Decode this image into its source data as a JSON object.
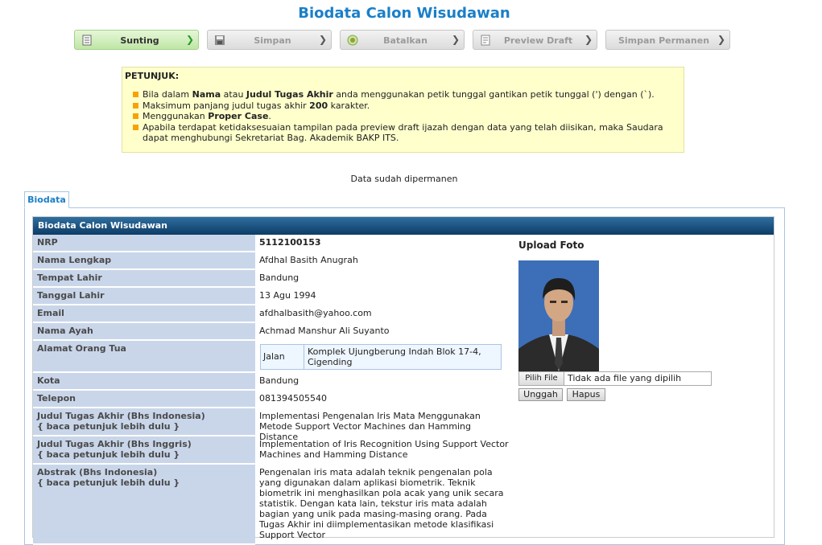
{
  "page_title": "Biodata Calon Wisudawan",
  "toolbar": [
    {
      "label": "Sunting",
      "icon": "edit-icon",
      "active": true
    },
    {
      "label": "Simpan",
      "icon": "save-icon",
      "active": false
    },
    {
      "label": "Batalkan",
      "icon": "cancel-icon",
      "active": false
    },
    {
      "label": "Preview Draft",
      "icon": "preview-icon",
      "active": false
    },
    {
      "label": "Simpan Permanen",
      "icon": "",
      "active": false
    }
  ],
  "petunjuk": {
    "heading": "PETUNJUK:",
    "item1": {
      "a": "Bila dalam ",
      "b": "Nama",
      "c": " atau ",
      "d": "Judul Tugas Akhir",
      "e": " anda menggunakan petik tunggal gantikan petik tunggal (') dengan (`)."
    },
    "item2": {
      "a": "Maksimum panjang judul tugas akhir ",
      "b": "200",
      "c": " karakter."
    },
    "item3": {
      "a": "Menggunakan ",
      "b": "Proper Case",
      "c": "."
    },
    "item4": "Apabila terdapat ketidaksesuaian tampilan pada preview draft ijazah dengan data yang telah diisikan, maka Saudara dapat menghubungi Sekretariat Bag. Akademik BAKP ITS."
  },
  "status_message": "Data sudah dipermanen",
  "tab_label": "Biodata",
  "form": {
    "header": "Biodata Calon Wisudawan",
    "nrp_label": "NRP",
    "nrp": "5112100153",
    "nama_label": "Nama Lengkap",
    "nama": "Afdhal Basith Anugrah",
    "tempat_label": "Tempat Lahir",
    "tempat": "Bandung",
    "tanggal_label": "Tanggal Lahir",
    "tanggal": "13 Agu 1994",
    "email_label": "Email",
    "email": "afdhalbasith@yahoo.com",
    "ayah_label": "Nama Ayah",
    "ayah": "Achmad Manshur Ali Suyanto",
    "alamat_label": "Alamat Orang Tua",
    "alamat_key": "Jalan",
    "alamat_value": "Komplek Ujungberung Indah Blok 17-4, Cigending",
    "kota_label": "Kota",
    "kota": "Bandung",
    "telepon_label": "Telepon",
    "telepon": "081394505540",
    "judul_id_label": "Judul Tugas Akhir (Bhs Indonesia)",
    "judul_id_hint": "{ baca petunjuk lebih dulu }",
    "judul_id": "Implementasi Pengenalan Iris Mata Menggunakan Metode Support Vector Machines dan Hamming Distance",
    "judul_en_label": "Judul Tugas Akhir (Bhs Inggris)",
    "judul_en_hint": "{ baca petunjuk lebih dulu }",
    "judul_en": "Implementation of Iris Recognition Using Support Vector Machines and Hamming Distance",
    "abstrak_label": "Abstrak (Bhs Indonesia)",
    "abstrak_hint": "{ baca petunjuk lebih dulu }",
    "abstrak": "Pengenalan iris mata adalah teknik pengenalan pola yang digunakan dalam aplikasi biometrik. Teknik biometrik ini menghasilkan pola acak yang unik secara statistik. Dengan kata lain, tekstur iris mata adalah bagian yang unik pada masing-masing orang. Pada Tugas Akhir ini diimplementasikan metode klasifikasi Support Vector"
  },
  "upload": {
    "title": "Upload Foto",
    "choose_button": "Pilih File",
    "no_file_text": "Tidak ada file yang dipilih",
    "upload_button": "Unggah",
    "delete_button": "Hapus"
  }
}
